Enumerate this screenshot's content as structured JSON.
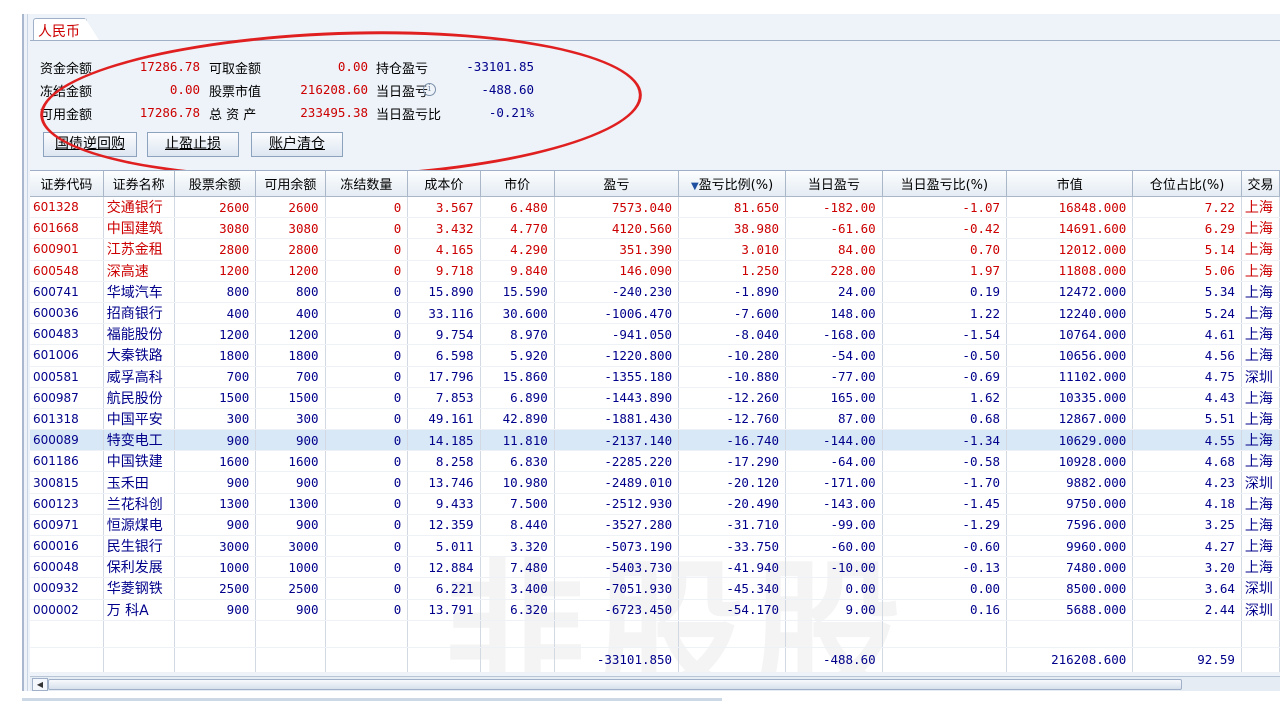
{
  "tab": {
    "label": "人民币"
  },
  "summary": [
    {
      "label": "资金余额",
      "value": "17286.78",
      "label2": "可取金额",
      "value2": "0.00",
      "label3": "持仓盈亏",
      "value3": "-33101.85"
    },
    {
      "label": "冻结金额",
      "value": "0.00",
      "label2": "股票市值",
      "value2": "216208.60",
      "label3": "当日盈亏",
      "value3": "-488.60"
    },
    {
      "label": "可用金额",
      "value": "17286.78",
      "label2": "总 资 产",
      "value2": "233495.38",
      "label3": "当日盈亏比",
      "value3": "-0.21%"
    }
  ],
  "buttons": {
    "repo": "国债逆回购",
    "stop": "止盈止损",
    "clear": "账户清仓"
  },
  "columns": [
    "证券代码",
    "证券名称",
    "股票余额",
    "可用余额",
    "冻结数量",
    "成本价",
    "市价",
    "盈亏",
    "盈亏比例(%)",
    "当日盈亏",
    "当日盈亏比(%)",
    "市值",
    "仓位占比(%)",
    "交易"
  ],
  "rows": [
    {
      "code": "601328",
      "name": "交通银行",
      "qty": "2600",
      "avail": "2600",
      "frozen": "0",
      "cost": "3.567",
      "price": "6.480",
      "pl": "7573.040",
      "plpct": "81.650",
      "dpl": "-182.00",
      "dplpct": "-1.07",
      "mv": "16848.000",
      "pos": "7.22",
      "mkt": "上海",
      "color": "red"
    },
    {
      "code": "601668",
      "name": "中国建筑",
      "qty": "3080",
      "avail": "3080",
      "frozen": "0",
      "cost": "3.432",
      "price": "4.770",
      "pl": "4120.560",
      "plpct": "38.980",
      "dpl": "-61.60",
      "dplpct": "-0.42",
      "mv": "14691.600",
      "pos": "6.29",
      "mkt": "上海",
      "color": "red"
    },
    {
      "code": "600901",
      "name": "江苏金租",
      "qty": "2800",
      "avail": "2800",
      "frozen": "0",
      "cost": "4.165",
      "price": "4.290",
      "pl": "351.390",
      "plpct": "3.010",
      "dpl": "84.00",
      "dplpct": "0.70",
      "mv": "12012.000",
      "pos": "5.14",
      "mkt": "上海",
      "color": "red"
    },
    {
      "code": "600548",
      "name": "深高速",
      "qty": "1200",
      "avail": "1200",
      "frozen": "0",
      "cost": "9.718",
      "price": "9.840",
      "pl": "146.090",
      "plpct": "1.250",
      "dpl": "228.00",
      "dplpct": "1.97",
      "mv": "11808.000",
      "pos": "5.06",
      "mkt": "上海",
      "color": "red"
    },
    {
      "code": "600741",
      "name": "华域汽车",
      "qty": "800",
      "avail": "800",
      "frozen": "0",
      "cost": "15.890",
      "price": "15.590",
      "pl": "-240.230",
      "plpct": "-1.890",
      "dpl": "24.00",
      "dplpct": "0.19",
      "mv": "12472.000",
      "pos": "5.34",
      "mkt": "上海",
      "color": "blue"
    },
    {
      "code": "600036",
      "name": "招商银行",
      "qty": "400",
      "avail": "400",
      "frozen": "0",
      "cost": "33.116",
      "price": "30.600",
      "pl": "-1006.470",
      "plpct": "-7.600",
      "dpl": "148.00",
      "dplpct": "1.22",
      "mv": "12240.000",
      "pos": "5.24",
      "mkt": "上海",
      "color": "blue"
    },
    {
      "code": "600483",
      "name": "福能股份",
      "qty": "1200",
      "avail": "1200",
      "frozen": "0",
      "cost": "9.754",
      "price": "8.970",
      "pl": "-941.050",
      "plpct": "-8.040",
      "dpl": "-168.00",
      "dplpct": "-1.54",
      "mv": "10764.000",
      "pos": "4.61",
      "mkt": "上海",
      "color": "blue"
    },
    {
      "code": "601006",
      "name": "大秦铁路",
      "qty": "1800",
      "avail": "1800",
      "frozen": "0",
      "cost": "6.598",
      "price": "5.920",
      "pl": "-1220.800",
      "plpct": "-10.280",
      "dpl": "-54.00",
      "dplpct": "-0.50",
      "mv": "10656.000",
      "pos": "4.56",
      "mkt": "上海",
      "color": "blue"
    },
    {
      "code": "000581",
      "name": "威孚高科",
      "qty": "700",
      "avail": "700",
      "frozen": "0",
      "cost": "17.796",
      "price": "15.860",
      "pl": "-1355.180",
      "plpct": "-10.880",
      "dpl": "-77.00",
      "dplpct": "-0.69",
      "mv": "11102.000",
      "pos": "4.75",
      "mkt": "深圳",
      "color": "blue"
    },
    {
      "code": "600987",
      "name": "航民股份",
      "qty": "1500",
      "avail": "1500",
      "frozen": "0",
      "cost": "7.853",
      "price": "6.890",
      "pl": "-1443.890",
      "plpct": "-12.260",
      "dpl": "165.00",
      "dplpct": "1.62",
      "mv": "10335.000",
      "pos": "4.43",
      "mkt": "上海",
      "color": "blue"
    },
    {
      "code": "601318",
      "name": "中国平安",
      "qty": "300",
      "avail": "300",
      "frozen": "0",
      "cost": "49.161",
      "price": "42.890",
      "pl": "-1881.430",
      "plpct": "-12.760",
      "dpl": "87.00",
      "dplpct": "0.68",
      "mv": "12867.000",
      "pos": "5.51",
      "mkt": "上海",
      "color": "blue"
    },
    {
      "code": "600089",
      "name": "特变电工",
      "qty": "900",
      "avail": "900",
      "frozen": "0",
      "cost": "14.185",
      "price": "11.810",
      "pl": "-2137.140",
      "plpct": "-16.740",
      "dpl": "-144.00",
      "dplpct": "-1.34",
      "mv": "10629.000",
      "pos": "4.55",
      "mkt": "上海",
      "color": "blue",
      "selected": true
    },
    {
      "code": "601186",
      "name": "中国铁建",
      "qty": "1600",
      "avail": "1600",
      "frozen": "0",
      "cost": "8.258",
      "price": "6.830",
      "pl": "-2285.220",
      "plpct": "-17.290",
      "dpl": "-64.00",
      "dplpct": "-0.58",
      "mv": "10928.000",
      "pos": "4.68",
      "mkt": "上海",
      "color": "blue"
    },
    {
      "code": "300815",
      "name": "玉禾田",
      "qty": "900",
      "avail": "900",
      "frozen": "0",
      "cost": "13.746",
      "price": "10.980",
      "pl": "-2489.010",
      "plpct": "-20.120",
      "dpl": "-171.00",
      "dplpct": "-1.70",
      "mv": "9882.000",
      "pos": "4.23",
      "mkt": "深圳",
      "color": "blue"
    },
    {
      "code": "600123",
      "name": "兰花科创",
      "qty": "1300",
      "avail": "1300",
      "frozen": "0",
      "cost": "9.433",
      "price": "7.500",
      "pl": "-2512.930",
      "plpct": "-20.490",
      "dpl": "-143.00",
      "dplpct": "-1.45",
      "mv": "9750.000",
      "pos": "4.18",
      "mkt": "上海",
      "color": "blue"
    },
    {
      "code": "600971",
      "name": "恒源煤电",
      "qty": "900",
      "avail": "900",
      "frozen": "0",
      "cost": "12.359",
      "price": "8.440",
      "pl": "-3527.280",
      "plpct": "-31.710",
      "dpl": "-99.00",
      "dplpct": "-1.29",
      "mv": "7596.000",
      "pos": "3.25",
      "mkt": "上海",
      "color": "blue"
    },
    {
      "code": "600016",
      "name": "民生银行",
      "qty": "3000",
      "avail": "3000",
      "frozen": "0",
      "cost": "5.011",
      "price": "3.320",
      "pl": "-5073.190",
      "plpct": "-33.750",
      "dpl": "-60.00",
      "dplpct": "-0.60",
      "mv": "9960.000",
      "pos": "4.27",
      "mkt": "上海",
      "color": "blue"
    },
    {
      "code": "600048",
      "name": "保利发展",
      "qty": "1000",
      "avail": "1000",
      "frozen": "0",
      "cost": "12.884",
      "price": "7.480",
      "pl": "-5403.730",
      "plpct": "-41.940",
      "dpl": "-10.00",
      "dplpct": "-0.13",
      "mv": "7480.000",
      "pos": "3.20",
      "mkt": "上海",
      "color": "blue"
    },
    {
      "code": "000932",
      "name": "华菱钢铁",
      "qty": "2500",
      "avail": "2500",
      "frozen": "0",
      "cost": "6.221",
      "price": "3.400",
      "pl": "-7051.930",
      "plpct": "-45.340",
      "dpl": "0.00",
      "dplpct": "0.00",
      "mv": "8500.000",
      "pos": "3.64",
      "mkt": "深圳",
      "color": "blue"
    },
    {
      "code": "000002",
      "name": "万 科A",
      "qty": "900",
      "avail": "900",
      "frozen": "0",
      "cost": "13.791",
      "price": "6.320",
      "pl": "-6723.450",
      "plpct": "-54.170",
      "dpl": "9.00",
      "dplpct": "0.16",
      "mv": "5688.000",
      "pos": "2.44",
      "mkt": "深圳",
      "color": "blue"
    }
  ],
  "totals": {
    "pl": "-33101.850",
    "dpl": "-488.60",
    "mv": "216208.600",
    "pos": "92.59"
  },
  "watermark": "韭股股",
  "colors": {
    "profit": "#cc0000",
    "loss": "#00008b",
    "selected_row": "#d8e8f6",
    "annotation_ellipse": "#e02020"
  }
}
